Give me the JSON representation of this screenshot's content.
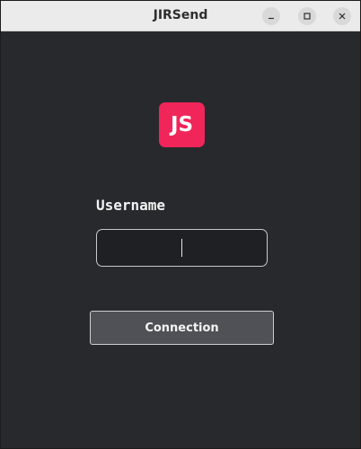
{
  "window": {
    "title": "JIRSend",
    "controls": {
      "minimize_icon": "minimize-icon",
      "maximize_icon": "maximize-icon",
      "close_icon": "close-icon"
    }
  },
  "logo": {
    "text": "JS",
    "color": "#f0255a"
  },
  "login": {
    "username_label": "Username",
    "username_value": "",
    "connect_label": "Connection"
  },
  "colors": {
    "background": "#28292d",
    "button": "#505156"
  }
}
